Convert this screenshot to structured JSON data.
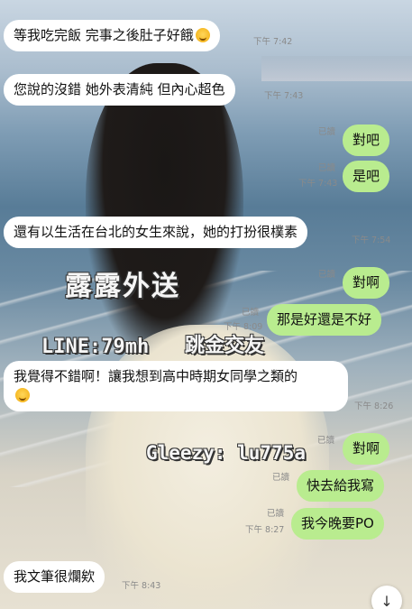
{
  "watermarks": {
    "brand": "露露外送",
    "line": "LINE:79mh",
    "other": "跳金交友",
    "gleezy": "Gleezy: lu775a"
  },
  "messages": [
    {
      "dir": "in",
      "text": "等我吃完飯 完事之後肚子好餓",
      "emoji": true,
      "read": "",
      "time": "下午 7:42"
    },
    {
      "dir": "in",
      "text": "您說的沒錯 她外表清純 但內心超色",
      "read": "",
      "time": "下午 7:43"
    },
    {
      "dir": "out",
      "text": "對吧",
      "read": "已讀",
      "time": ""
    },
    {
      "dir": "out",
      "text": "是吧",
      "read": "已讀",
      "time": "下午 7:43"
    },
    {
      "dir": "in",
      "text": "還有以生活在台北的女生來說，她的打扮很樸素",
      "read": "",
      "time": "下午 7:54"
    },
    {
      "dir": "out",
      "text": "對啊",
      "read": "已讀",
      "time": ""
    },
    {
      "dir": "out",
      "text": "那是好還是不好",
      "read": "已讀",
      "time": "下午 8:09"
    },
    {
      "dir": "in",
      "text": "我覺得不錯啊！讓我想到高中時期女同學之類的",
      "emoji": true,
      "read": "",
      "time": "下午 8:26"
    },
    {
      "dir": "out",
      "text": "對啊",
      "read": "已讀",
      "time": ""
    },
    {
      "dir": "out",
      "text": "快去給我寫",
      "read": "已讀",
      "time": ""
    },
    {
      "dir": "out",
      "text": "我今晚要PO",
      "read": "已讀",
      "time": "下午 8:27"
    },
    {
      "dir": "in",
      "text": "我文筆很爛欸",
      "read": "",
      "time": "下午 8:43"
    }
  ],
  "icons": {
    "scroll_down": "arrow-down-icon"
  }
}
